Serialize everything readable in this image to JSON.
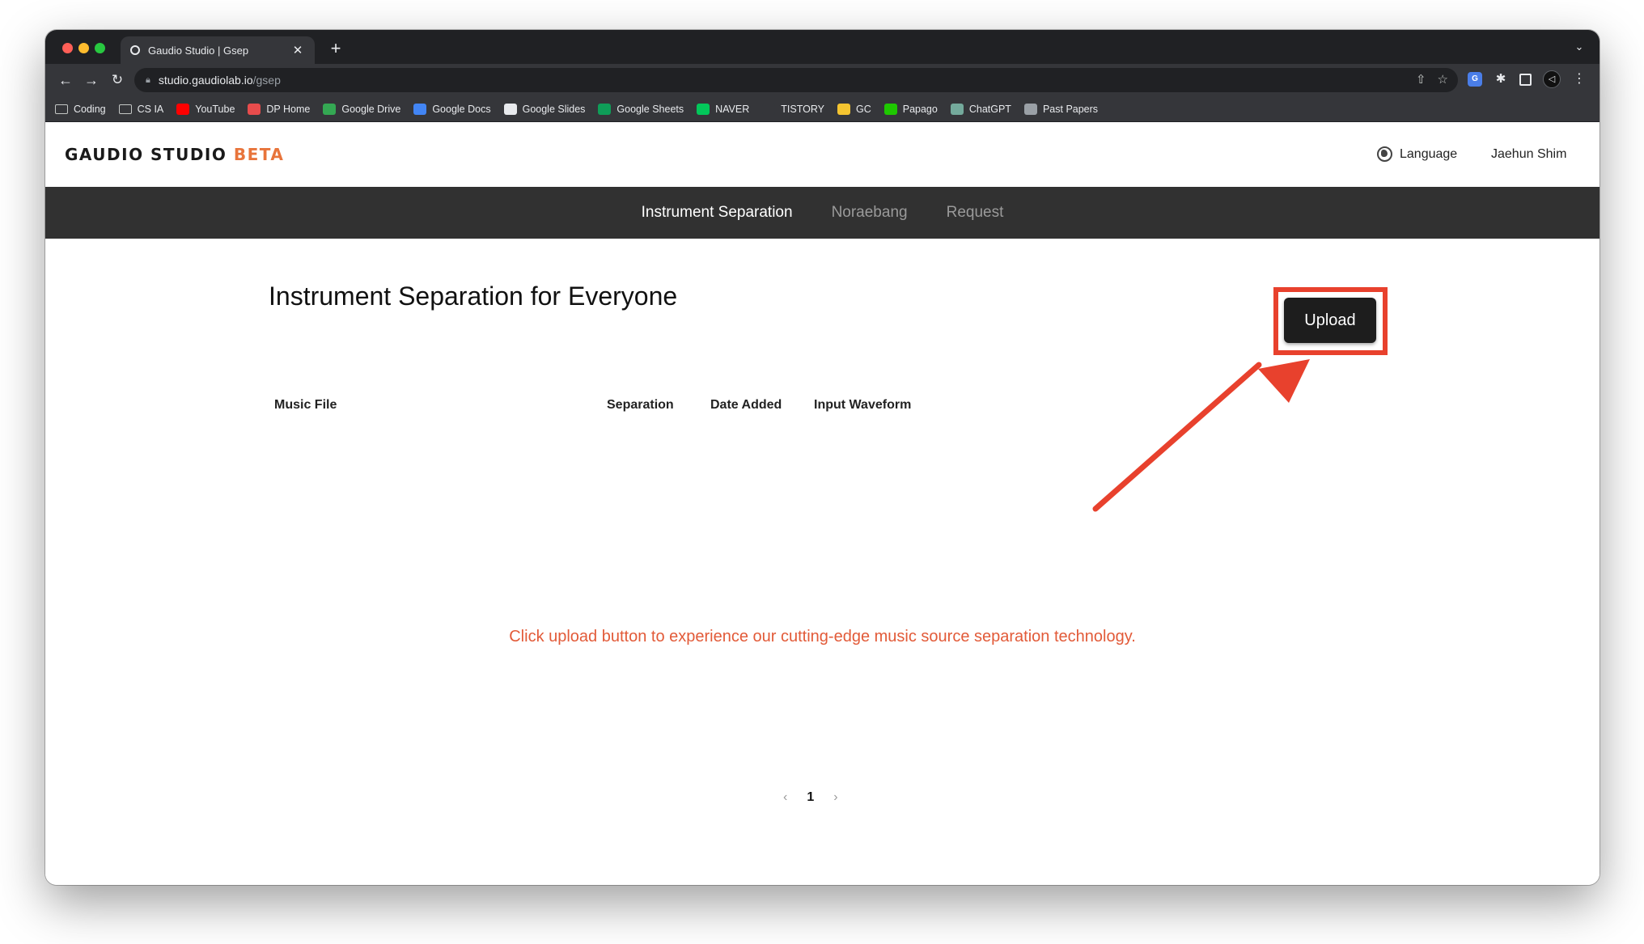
{
  "browser": {
    "tab_title": "Gaudio Studio | Gsep",
    "url_host": "studio.gaudiolab.io",
    "url_path": "/gsep",
    "bookmarks": [
      {
        "label": "Coding",
        "icon": "folder-icon"
      },
      {
        "label": "CS IA",
        "icon": "folder-icon"
      },
      {
        "label": "YouTube",
        "icon": "youtube-icon",
        "color": "#ff0000"
      },
      {
        "label": "DP Home",
        "icon": "dp-home-icon",
        "color": "#e74c4c"
      },
      {
        "label": "Google Drive",
        "icon": "google-drive-icon",
        "color": "#34a853"
      },
      {
        "label": "Google Docs",
        "icon": "google-docs-icon",
        "color": "#4285f4"
      },
      {
        "label": "Google Slides",
        "icon": "google-icon",
        "color": "#e8eaed"
      },
      {
        "label": "Google Sheets",
        "icon": "google-sheets-icon",
        "color": "#0f9d58"
      },
      {
        "label": "NAVER",
        "icon": "naver-icon",
        "color": "#03c75a"
      },
      {
        "label": "TISTORY",
        "icon": "tistory-icon",
        "color": "#35363a"
      },
      {
        "label": "GC",
        "icon": "gc-icon",
        "color": "#f4c430"
      },
      {
        "label": "Papago",
        "icon": "papago-icon",
        "color": "#1ec800"
      },
      {
        "label": "ChatGPT",
        "icon": "chatgpt-icon",
        "color": "#74aa9c"
      },
      {
        "label": "Past Papers",
        "icon": "past-papers-icon",
        "color": "#9aa0a6"
      }
    ]
  },
  "header": {
    "logo_main": "GAUDIO STUDIO ",
    "logo_beta": "BETA",
    "language_label": "Language",
    "user_name": "Jaehun Shim"
  },
  "nav": {
    "items": [
      {
        "label": "Instrument Separation",
        "active": true
      },
      {
        "label": "Noraebang",
        "active": false
      },
      {
        "label": "Request",
        "active": false
      }
    ]
  },
  "main": {
    "title": "Instrument Separation for Everyone",
    "upload_label": "Upload",
    "columns": [
      "Music File",
      "Separation",
      "Date Added",
      "Input Waveform"
    ],
    "hint": "Click upload button to experience our cutting-edge music source separation technology.",
    "pagination": {
      "prev": "‹",
      "current": "1",
      "next": "›"
    }
  },
  "colors": {
    "accent": "#e8743b",
    "highlight": "#e8412d",
    "hint_text": "#e25a38",
    "nav_bg": "#313131"
  }
}
